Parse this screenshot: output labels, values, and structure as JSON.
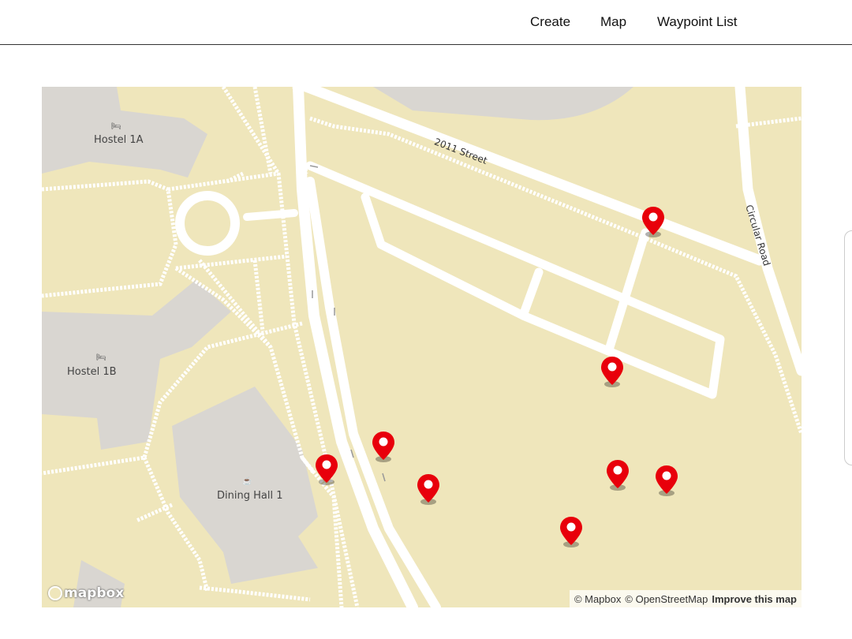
{
  "nav": {
    "links": [
      "Create",
      "Map",
      "Waypoint List"
    ]
  },
  "map": {
    "places": {
      "hostel_1a": "Hostel 1A",
      "hostel_1b": "Hostel 1B",
      "dining_hall": "Dining Hall 1"
    },
    "streets": {
      "street_2011": "2011 Street",
      "circular_road": "Circular Road"
    },
    "markers": [
      {
        "id": "waypoint-1"
      },
      {
        "id": "waypoint-2"
      },
      {
        "id": "waypoint-3"
      },
      {
        "id": "waypoint-4"
      },
      {
        "id": "waypoint-5"
      },
      {
        "id": "waypoint-6"
      },
      {
        "id": "waypoint-7"
      },
      {
        "id": "waypoint-8"
      }
    ],
    "marker_color": "#e8000b",
    "logo_text": "mapbox",
    "attribution": {
      "mapbox": "© Mapbox",
      "osm": "© OpenStreetMap",
      "improve": "Improve this map"
    },
    "icons": {
      "hostel": "bed-icon",
      "dining": "cafe-icon"
    }
  }
}
